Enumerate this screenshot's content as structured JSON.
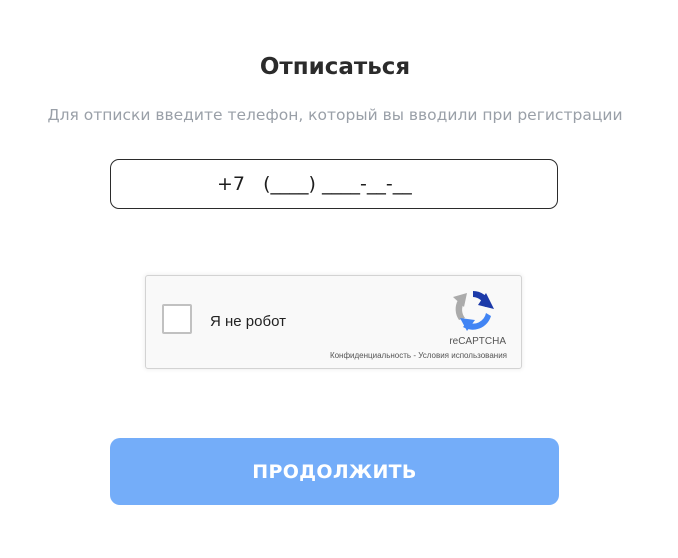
{
  "page": {
    "title": "Отписаться",
    "subtitle": "Для отписки введите телефон, который вы вводили при регистрации"
  },
  "phone_input": {
    "value": "+7   (____) ____-__-__"
  },
  "captcha": {
    "label": "Я не робот",
    "brand": "reCAPTCHA",
    "privacy_link": "Конфиденциальность",
    "separator": " - ",
    "terms_link": "Условия использования",
    "checked": false,
    "icon": "recaptcha-logo-icon"
  },
  "submit": {
    "label": "ПРОДОЛЖИТЬ",
    "color": "#74adf9"
  }
}
